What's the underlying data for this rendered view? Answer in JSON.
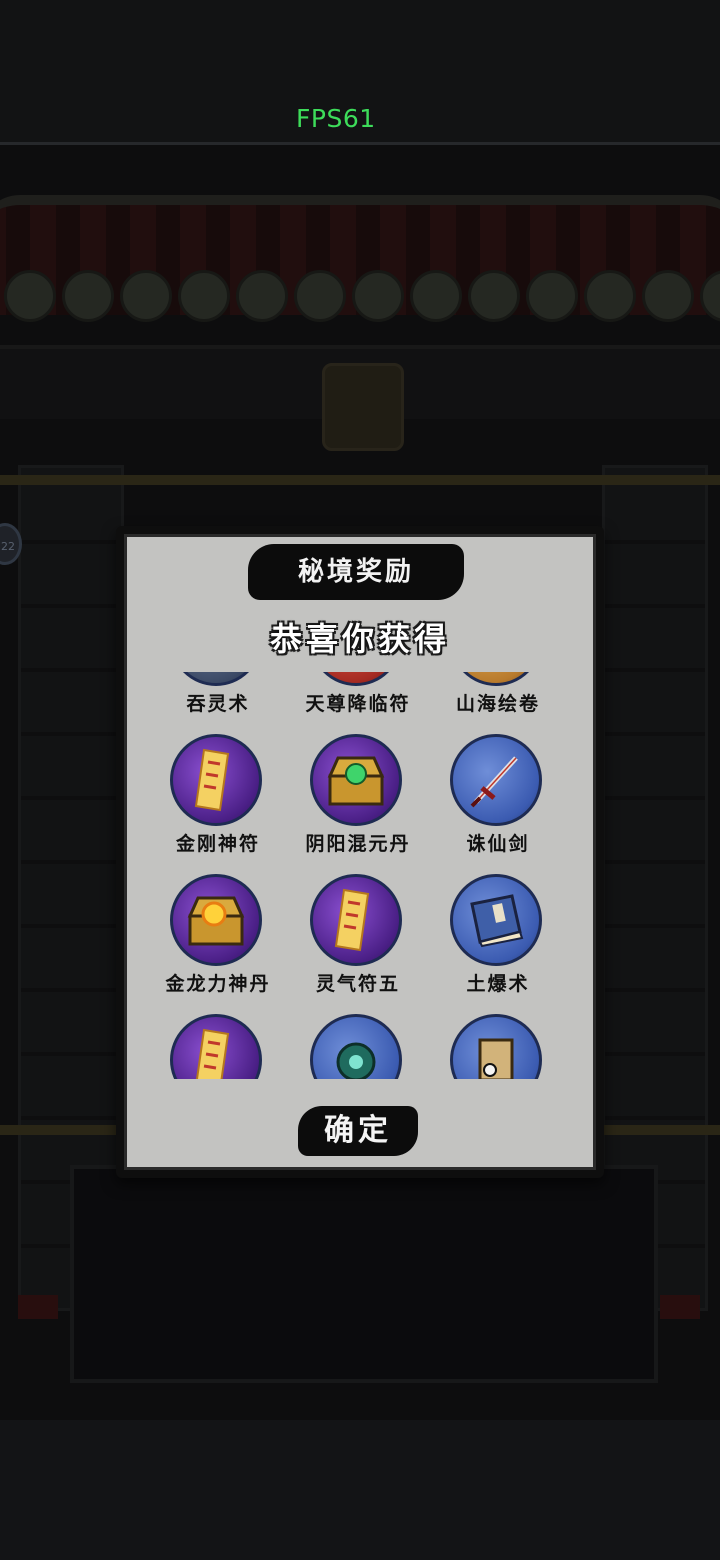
{
  "hud": {
    "fps": "FPS61",
    "fps_color": "#3ddc5a",
    "side_badge": "22"
  },
  "dialog": {
    "title": "秘境奖励",
    "subtitle": "恭喜你获得",
    "confirm_label": "确定"
  },
  "rewards": [
    {
      "name": "吞灵术",
      "icon": "scroll-book-icon",
      "frame": "slate"
    },
    {
      "name": "天尊降临符",
      "icon": "talisman-icon",
      "frame": "red"
    },
    {
      "name": "山海绘卷",
      "icon": "painted-scroll-icon",
      "frame": "gold"
    },
    {
      "name": "金刚神符",
      "icon": "talisman-icon",
      "frame": "purple"
    },
    {
      "name": "阴阳混元丹",
      "icon": "treasure-chest-green-pill-icon",
      "frame": "purple"
    },
    {
      "name": "诛仙剑",
      "icon": "sword-icon",
      "frame": "blue"
    },
    {
      "name": "金龙力神丹",
      "icon": "treasure-chest-gold-pill-icon",
      "frame": "purple"
    },
    {
      "name": "灵气符五",
      "icon": "talisman-icon",
      "frame": "purple"
    },
    {
      "name": "土爆术",
      "icon": "skill-book-icon",
      "frame": "blue"
    },
    {
      "name": "",
      "icon": "talisman-icon",
      "frame": "purple"
    },
    {
      "name": "",
      "icon": "spirit-orb-icon",
      "frame": "blue"
    },
    {
      "name": "",
      "icon": "treasure-box-icon",
      "frame": "blue"
    }
  ]
}
